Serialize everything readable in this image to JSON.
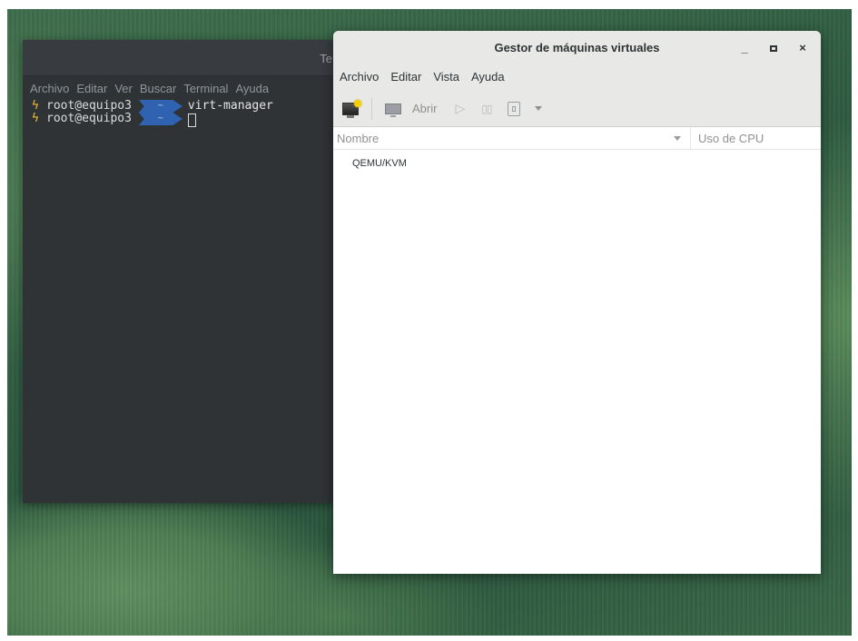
{
  "terminal": {
    "title_partial": "Te",
    "menu": [
      "Archivo",
      "Editar",
      "Ver",
      "Buscar",
      "Terminal",
      "Ayuda"
    ],
    "lines": [
      {
        "user": "root@equipo3",
        "dir": "~",
        "command": "virt-manager"
      },
      {
        "user": "root@equipo3",
        "dir": "~",
        "command": ""
      }
    ]
  },
  "vmm": {
    "title": "Gestor de máquinas virtuales",
    "controls": {
      "minimize": "_",
      "maximize": "▫",
      "close": "×"
    },
    "menu": [
      "Archivo",
      "Editar",
      "Vista",
      "Ayuda"
    ],
    "toolbar": {
      "new_icon": "new-vm-icon",
      "open_label": "Abrir",
      "run_icon": "play-icon",
      "pause_icon": "pause-icon",
      "shutdown_icon": "shutdown-icon",
      "dropdown_icon": "chevron-down-icon"
    },
    "columns": {
      "name": "Nombre",
      "cpu": "Uso de CPU"
    },
    "rows": [
      {
        "name": "QEMU/KVM"
      }
    ]
  }
}
